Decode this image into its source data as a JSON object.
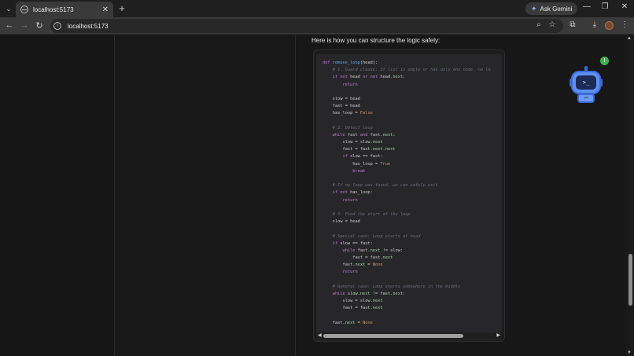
{
  "browser": {
    "tab_title": "localhost:5173",
    "new_tab": "+",
    "tab_close": "✕",
    "ask_gemini": "Ask Gemini",
    "url": "localhost:5173",
    "win_minimize": "—",
    "win_restore": "❐",
    "win_close": "✕"
  },
  "main": {
    "intro": "Here is how you can structure the logic safely:",
    "code_lines": [
      [
        {
          "t": "def",
          "c": "kw"
        },
        {
          "t": " "
        },
        {
          "t": "remove_loop",
          "c": "fn"
        },
        {
          "t": "(head):"
        }
      ],
      [
        {
          "t": "    "
        },
        {
          "t": "# 1. Guard clause: If list is empty or has only one node, no lo",
          "c": "cm"
        }
      ],
      [
        {
          "t": "    "
        },
        {
          "t": "if not",
          "c": "kw"
        },
        {
          "t": " head "
        },
        {
          "t": "or not",
          "c": "kw"
        },
        {
          "t": " head."
        },
        {
          "t": "next",
          "c": "at"
        },
        {
          "t": ":"
        }
      ],
      [
        {
          "t": "        "
        },
        {
          "t": "return",
          "c": "kw"
        }
      ],
      [
        {
          "t": ""
        }
      ],
      [
        {
          "t": "    slow = head"
        }
      ],
      [
        {
          "t": "    fast = head"
        }
      ],
      [
        {
          "t": "    has_loop = "
        },
        {
          "t": "False",
          "c": "bl"
        }
      ],
      [
        {
          "t": ""
        }
      ],
      [
        {
          "t": "    "
        },
        {
          "t": "# 2. Detect loop",
          "c": "cm"
        }
      ],
      [
        {
          "t": "    "
        },
        {
          "t": "while",
          "c": "kw"
        },
        {
          "t": " fast "
        },
        {
          "t": "and",
          "c": "kw"
        },
        {
          "t": " fast."
        },
        {
          "t": "next",
          "c": "at"
        },
        {
          "t": ":"
        }
      ],
      [
        {
          "t": "        slow = slow."
        },
        {
          "t": "next",
          "c": "at"
        }
      ],
      [
        {
          "t": "        fast = fast."
        },
        {
          "t": "next",
          "c": "at"
        },
        {
          "t": "."
        },
        {
          "t": "next",
          "c": "at"
        }
      ],
      [
        {
          "t": "        "
        },
        {
          "t": "if",
          "c": "kw"
        },
        {
          "t": " slow == fast:"
        }
      ],
      [
        {
          "t": "            has_loop = "
        },
        {
          "t": "True",
          "c": "bl"
        }
      ],
      [
        {
          "t": "            "
        },
        {
          "t": "break",
          "c": "kw"
        }
      ],
      [
        {
          "t": ""
        }
      ],
      [
        {
          "t": "    "
        },
        {
          "t": "# If no loop was found, we can safely exit",
          "c": "cm"
        }
      ],
      [
        {
          "t": "    "
        },
        {
          "t": "if not",
          "c": "kw"
        },
        {
          "t": " has_loop:"
        }
      ],
      [
        {
          "t": "        "
        },
        {
          "t": "return",
          "c": "kw"
        }
      ],
      [
        {
          "t": ""
        }
      ],
      [
        {
          "t": "    "
        },
        {
          "t": "# 3. Find the start of the loop",
          "c": "cm"
        }
      ],
      [
        {
          "t": "    slow = head"
        }
      ],
      [
        {
          "t": ""
        }
      ],
      [
        {
          "t": "    "
        },
        {
          "t": "# Special case: Loop starts at head",
          "c": "cm"
        }
      ],
      [
        {
          "t": "    "
        },
        {
          "t": "if",
          "c": "kw"
        },
        {
          "t": " slow == fast:"
        }
      ],
      [
        {
          "t": "        "
        },
        {
          "t": "while",
          "c": "kw"
        },
        {
          "t": " fast."
        },
        {
          "t": "next",
          "c": "at"
        },
        {
          "t": " != slow:"
        }
      ],
      [
        {
          "t": "            fast = fast."
        },
        {
          "t": "next",
          "c": "at"
        }
      ],
      [
        {
          "t": "        fast."
        },
        {
          "t": "next",
          "c": "at"
        },
        {
          "t": " = "
        },
        {
          "t": "None",
          "c": "bl"
        }
      ],
      [
        {
          "t": "        "
        },
        {
          "t": "return",
          "c": "kw"
        }
      ],
      [
        {
          "t": ""
        }
      ],
      [
        {
          "t": "    "
        },
        {
          "t": "# General case: Loop starts somewhere in the middle",
          "c": "cm"
        }
      ],
      [
        {
          "t": "    "
        },
        {
          "t": "while",
          "c": "kw"
        },
        {
          "t": " slow."
        },
        {
          "t": "next",
          "c": "at"
        },
        {
          "t": " != fast."
        },
        {
          "t": "next",
          "c": "at"
        },
        {
          "t": ":"
        }
      ],
      [
        {
          "t": "        slow = slow."
        },
        {
          "t": "next",
          "c": "at"
        }
      ],
      [
        {
          "t": "        fast = fast."
        },
        {
          "t": "next",
          "c": "at"
        }
      ],
      [
        {
          "t": ""
        }
      ],
      [
        {
          "t": "    fast."
        },
        {
          "t": "next",
          "c": "at"
        },
        {
          "t": " = "
        },
        {
          "t": "None",
          "c": "bl"
        }
      ]
    ]
  },
  "assistant": {
    "screen_glyph": ">_",
    "body_glyph": ">=",
    "badge": "!"
  },
  "colors": {
    "keyword": "#c678dd",
    "function": "#61afef",
    "comment": "#6b6f78",
    "literal": "#d19a66",
    "attribute": "#a6d4a0",
    "bot": "#5d8ff0",
    "badge": "#3ab44a"
  },
  "icons": [
    "tab-search-icon",
    "globe-icon",
    "close-icon",
    "plus-icon",
    "gemini-spark-icon",
    "minimize-icon",
    "restore-icon",
    "back-arrow-icon",
    "forward-arrow-icon",
    "reload-icon",
    "site-info-icon",
    "zoom-icon",
    "bookmark-star-icon",
    "extensions-icon",
    "download-icon",
    "avatar",
    "more-menu-icon",
    "robot-assistant-icon",
    "notification-badge"
  ]
}
